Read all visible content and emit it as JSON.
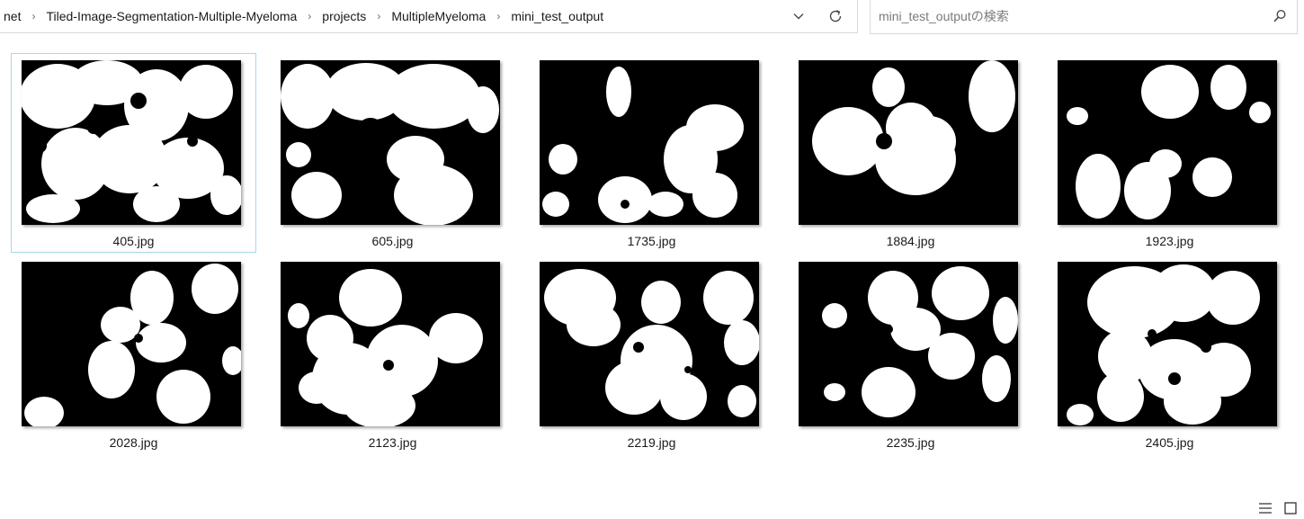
{
  "address": {
    "crumbs": [
      "net",
      "Tiled-Image-Segmentation-Multiple-Myeloma",
      "projects",
      "MultipleMyeloma",
      "mini_test_output"
    ]
  },
  "search": {
    "placeholder": "mini_test_outputの検索"
  },
  "icons": {
    "dropdown": "chevron-down-icon",
    "refresh": "refresh-icon",
    "search": "search-icon",
    "details_view": "details-view-icon",
    "large_icons_view": "large-icons-view-icon"
  },
  "files": [
    {
      "name": "405.jpg",
      "selected": true
    },
    {
      "name": "605.jpg",
      "selected": false
    },
    {
      "name": "1735.jpg",
      "selected": false
    },
    {
      "name": "1884.jpg",
      "selected": false
    },
    {
      "name": "1923.jpg",
      "selected": false
    },
    {
      "name": "2028.jpg",
      "selected": false
    },
    {
      "name": "2123.jpg",
      "selected": false
    },
    {
      "name": "2219.jpg",
      "selected": false
    },
    {
      "name": "2235.jpg",
      "selected": false
    },
    {
      "name": "2405.jpg",
      "selected": false
    }
  ]
}
